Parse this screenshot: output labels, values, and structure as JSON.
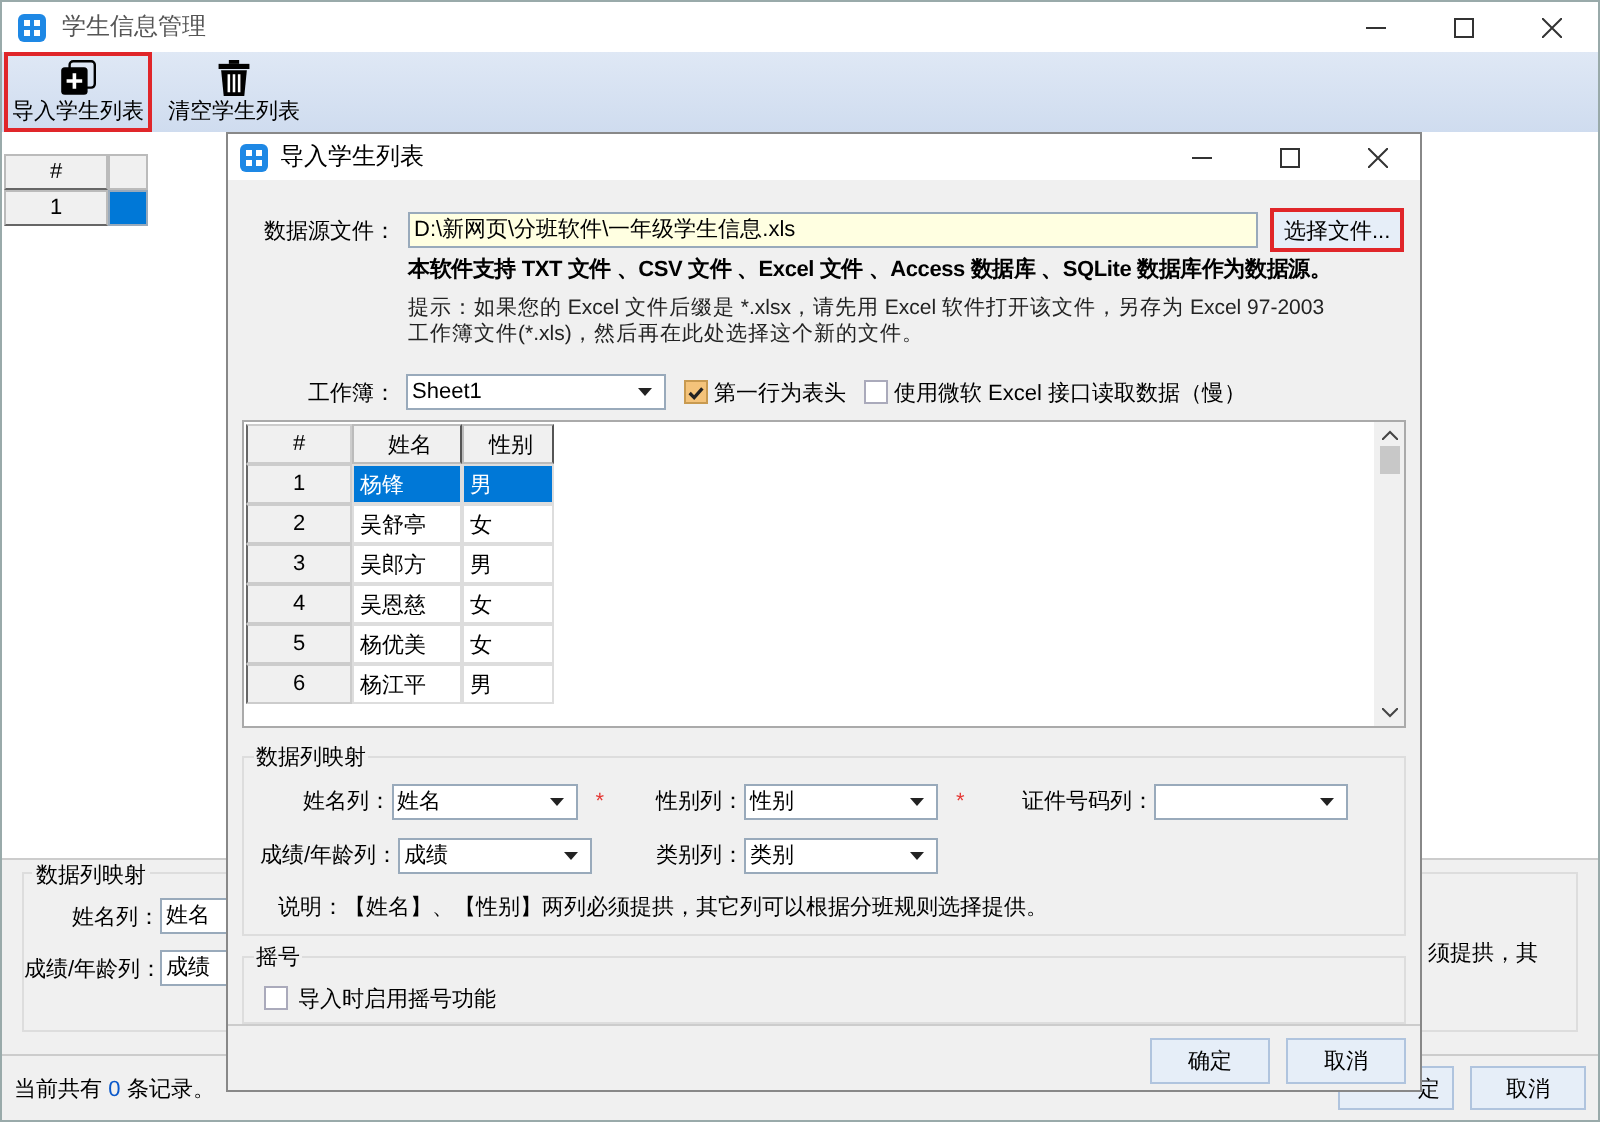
{
  "window": {
    "title": "学生信息管理"
  },
  "toolbar": [
    {
      "label": "导入学生列表",
      "kind": "add",
      "highlighted": true
    },
    {
      "label": "清空学生列表",
      "kind": "trash",
      "highlighted": false
    }
  ],
  "main_grid": {
    "header": "#",
    "rows": [
      {
        "index": "1",
        "selected": true
      }
    ]
  },
  "mapping": {
    "title": "数据列映射",
    "fields": [
      {
        "label": "姓名列：",
        "value": "姓名"
      },
      {
        "label": "成绩/年龄列：",
        "value": "成绩"
      }
    ],
    "note": "须提拱，其"
  },
  "status_bar": {
    "prefix": "当前共有",
    "count": "0",
    "suffix": "条记录。"
  },
  "buttons": [
    {
      "label": "定"
    },
    {
      "label": "取消"
    }
  ],
  "dialog": {
    "title": "导入学生列表",
    "source": {
      "label": "数据源文件：",
      "value": "D:\\新网页\\分班软件\\一年级学生信息.xls",
      "button": "选择文件...",
      "highlighted": true
    },
    "support": "本软件支持 TXT 文件 、CSV 文件 、Excel 文件 、Access 数据库 、SQLite 数据库作为数据源。",
    "hint": [
      "提示：如果您的 Excel 文件后缀是 *.xlsx，请先用 Excel 软件打开该文件，另存为 Excel 97-2003",
      "工作簿文件(*.xls)，然后再在此处选择这个新的文件。"
    ],
    "workbook": {
      "label": "工作簿：",
      "value": "Sheet1"
    },
    "options": [
      {
        "label": "第一行为表头",
        "checked": true
      },
      {
        "label": "使用微软 Excel 接口读取数据（慢）",
        "checked": false
      }
    ],
    "table": {
      "columns": [
        "#",
        "姓名",
        "性别"
      ],
      "rows": [
        {
          "index": "1",
          "name": "杨锋",
          "gender": "男",
          "selected": true
        },
        {
          "index": "2",
          "name": "吴舒亭",
          "gender": "女",
          "selected": false
        },
        {
          "index": "3",
          "name": "吴郎方",
          "gender": "男",
          "selected": false
        },
        {
          "index": "4",
          "name": "吴恩慈",
          "gender": "女",
          "selected": false
        },
        {
          "index": "5",
          "name": "杨优美",
          "gender": "女",
          "selected": false
        },
        {
          "index": "6",
          "name": "杨江平",
          "gender": "男",
          "selected": false
        }
      ]
    },
    "mapping": {
      "title": "数据列映射",
      "rows": [
        [
          {
            "label": "姓名列：",
            "value": "姓名",
            "mark": "*"
          },
          {
            "label": "性别列：",
            "value": "性别",
            "mark": "*"
          },
          {
            "label": "证件号码列："
          }
        ],
        [
          {
            "label": "成绩/年龄列：",
            "value": "成绩"
          },
          {
            "label": "类别列：",
            "value": "类别"
          }
        ]
      ],
      "note": "说明：【姓名】、【性别】两列必须提拱，其它列可以根据分班规则选择提供。"
    },
    "lottery": {
      "title": "摇号",
      "option": {
        "label": "导入时启用摇号功能",
        "checked": false
      }
    },
    "buttons": [
      {
        "label": "确定"
      },
      {
        "label": "取消"
      }
    ]
  }
}
